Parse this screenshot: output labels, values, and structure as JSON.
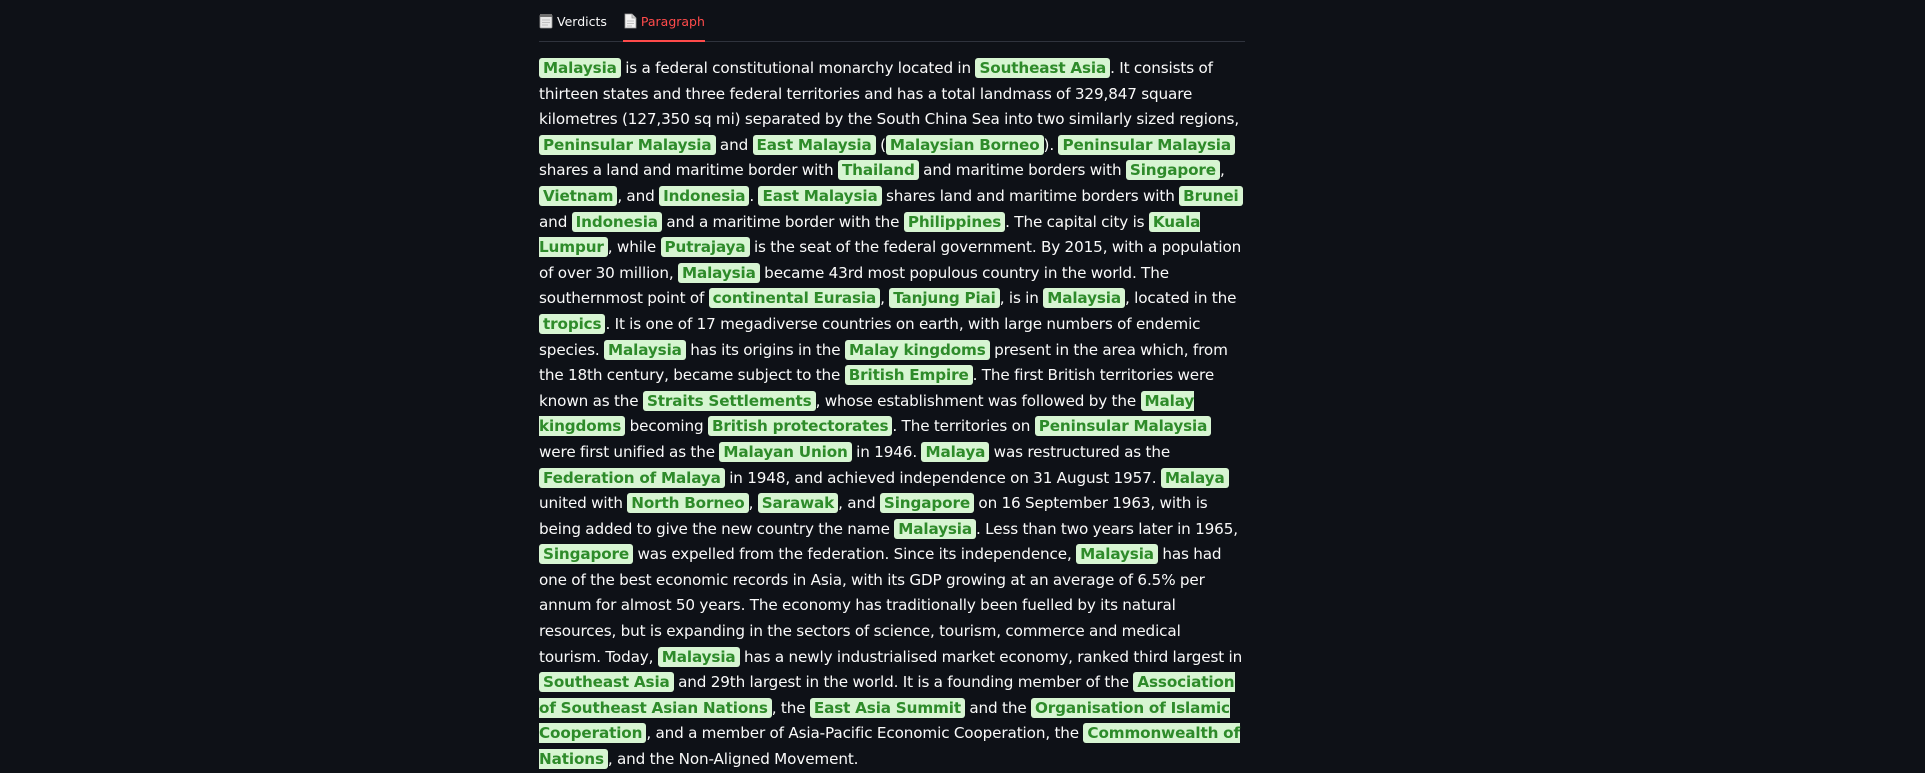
{
  "tabs": [
    {
      "label": "Verdicts",
      "icon": "notepad-icon",
      "active": false
    },
    {
      "label": "Paragraph",
      "icon": "document-icon",
      "active": true
    }
  ],
  "colors": {
    "background": "#0e1117",
    "text": "#fafafa",
    "accent": "#ff4b4b",
    "entity_bg": "#d7f5d2",
    "entity_text": "#2e8b2a"
  },
  "paragraph": [
    {
      "t": "Malaysia",
      "e": true
    },
    {
      "t": " is a federal constitutional monarchy located in "
    },
    {
      "t": "Southeast Asia",
      "e": true
    },
    {
      "t": ". It consists of thirteen states and three federal territories and has a total landmass of 329,847 square kilometres (127,350 sq mi) separated by the South China Sea into two similarly sized regions, "
    },
    {
      "t": "Peninsular Malaysia",
      "e": true
    },
    {
      "t": " and "
    },
    {
      "t": "East Malaysia",
      "e": true
    },
    {
      "t": " ("
    },
    {
      "t": "Malaysian Borneo",
      "e": true
    },
    {
      "t": "). "
    },
    {
      "t": "Peninsular Malaysia",
      "e": true
    },
    {
      "t": " shares a land and maritime border with "
    },
    {
      "t": "Thailand",
      "e": true
    },
    {
      "t": " and maritime borders with "
    },
    {
      "t": "Singapore",
      "e": true
    },
    {
      "t": ", "
    },
    {
      "t": "Vietnam",
      "e": true
    },
    {
      "t": ", and "
    },
    {
      "t": "Indonesia",
      "e": true
    },
    {
      "t": ". "
    },
    {
      "t": "East Malaysia",
      "e": true
    },
    {
      "t": " shares land and maritime borders with "
    },
    {
      "t": "Brunei",
      "e": true
    },
    {
      "t": " and "
    },
    {
      "t": "Indonesia",
      "e": true
    },
    {
      "t": " and a maritime border with the "
    },
    {
      "t": "Philippines",
      "e": true
    },
    {
      "t": ". The capital city is "
    },
    {
      "t": "Kuala Lumpur",
      "e": true
    },
    {
      "t": ", while "
    },
    {
      "t": "Putrajaya",
      "e": true
    },
    {
      "t": " is the seat of the federal government. By 2015, with a population of over 30 million, "
    },
    {
      "t": "Malaysia",
      "e": true
    },
    {
      "t": " became 43rd most populous country in the world. The southernmost point of "
    },
    {
      "t": "continental Eurasia",
      "e": true
    },
    {
      "t": ", "
    },
    {
      "t": "Tanjung Piai",
      "e": true
    },
    {
      "t": ", is in "
    },
    {
      "t": "Malaysia",
      "e": true
    },
    {
      "t": ", located in the "
    },
    {
      "t": "tropics",
      "e": true
    },
    {
      "t": ". It is one of 17 megadiverse countries on earth, with large numbers of endemic species. "
    },
    {
      "t": "Malaysia",
      "e": true
    },
    {
      "t": " has its origins in the "
    },
    {
      "t": "Malay kingdoms",
      "e": true
    },
    {
      "t": " present in the area which, from the 18th century, became subject to the "
    },
    {
      "t": "British Empire",
      "e": true
    },
    {
      "t": ". The first British territories were known as the "
    },
    {
      "t": "Straits Settlements",
      "e": true
    },
    {
      "t": ", whose establishment was followed by the "
    },
    {
      "t": "Malay kingdoms",
      "e": true
    },
    {
      "t": " becoming "
    },
    {
      "t": "British protectorates",
      "e": true
    },
    {
      "t": ". The territories on "
    },
    {
      "t": "Peninsular Malaysia",
      "e": true
    },
    {
      "t": " were first unified as the "
    },
    {
      "t": "Malayan Union",
      "e": true
    },
    {
      "t": " in 1946. "
    },
    {
      "t": "Malaya",
      "e": true
    },
    {
      "t": " was restructured as the "
    },
    {
      "t": "Federation of Malaya",
      "e": true
    },
    {
      "t": " in 1948, and achieved independence on 31 August 1957. "
    },
    {
      "t": "Malaya",
      "e": true
    },
    {
      "t": " united with "
    },
    {
      "t": "North Borneo",
      "e": true
    },
    {
      "t": ", "
    },
    {
      "t": "Sarawak",
      "e": true
    },
    {
      "t": ", and "
    },
    {
      "t": "Singapore",
      "e": true
    },
    {
      "t": " on 16 September 1963, with is being added to give the new country the name "
    },
    {
      "t": "Malaysia",
      "e": true
    },
    {
      "t": ". Less than two years later in 1965, "
    },
    {
      "t": "Singapore",
      "e": true
    },
    {
      "t": " was expelled from the federation. Since its independence, "
    },
    {
      "t": "Malaysia",
      "e": true
    },
    {
      "t": " has had one of the best economic records in Asia, with its GDP growing at an average of 6.5% per annum for almost 50 years. The economy has traditionally been fuelled by its natural resources, but is expanding in the sectors of science, tourism, commerce and medical tourism. Today, "
    },
    {
      "t": "Malaysia",
      "e": true
    },
    {
      "t": " has a newly industrialised market economy, ranked third largest in "
    },
    {
      "t": "Southeast Asia",
      "e": true
    },
    {
      "t": " and 29th largest in the world. It is a founding member of the "
    },
    {
      "t": "Association of Southeast Asian Nations",
      "e": true
    },
    {
      "t": ", the "
    },
    {
      "t": "East Asia Summit",
      "e": true
    },
    {
      "t": " and the "
    },
    {
      "t": "Organisation of Islamic Cooperation",
      "e": true
    },
    {
      "t": ", and a member of Asia-Pacific Economic Cooperation, the "
    },
    {
      "t": "Commonwealth of Nations",
      "e": true
    },
    {
      "t": ", and the Non-Aligned Movement."
    }
  ]
}
